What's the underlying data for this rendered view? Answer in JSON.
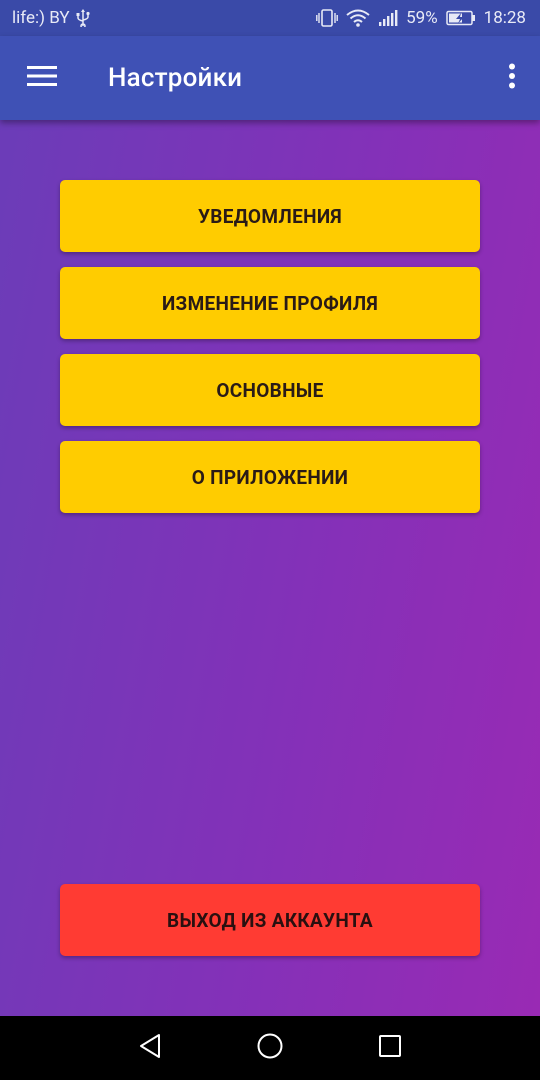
{
  "status_bar": {
    "carrier": "life:) BY",
    "usb_icon": "usb-icon",
    "battery_percent": "59%",
    "time": "18:28",
    "icons": [
      "vibrate-icon",
      "wifi-icon",
      "signal-icon",
      "battery-charging-icon"
    ]
  },
  "app_bar": {
    "title": "Настройки",
    "menu_icon": "hamburger-menu-icon",
    "overflow_icon": "more-vert-icon",
    "color": "#3F51B5"
  },
  "settings": {
    "buttons": [
      {
        "label": "УВЕДОМЛЕНИЯ"
      },
      {
        "label": "ИЗМЕНЕНИЕ ПРОФИЛЯ"
      },
      {
        "label": "ОСНОВНЫЕ"
      },
      {
        "label": "О ПРИЛОЖЕНИИ"
      }
    ],
    "button_color": "#FFCC00"
  },
  "logout": {
    "label": "ВЫХОД ИЗ АККАУНТА",
    "color": "#FF3B33"
  },
  "nav_bar": {
    "icons": [
      "back-icon",
      "home-icon",
      "recents-icon"
    ]
  }
}
